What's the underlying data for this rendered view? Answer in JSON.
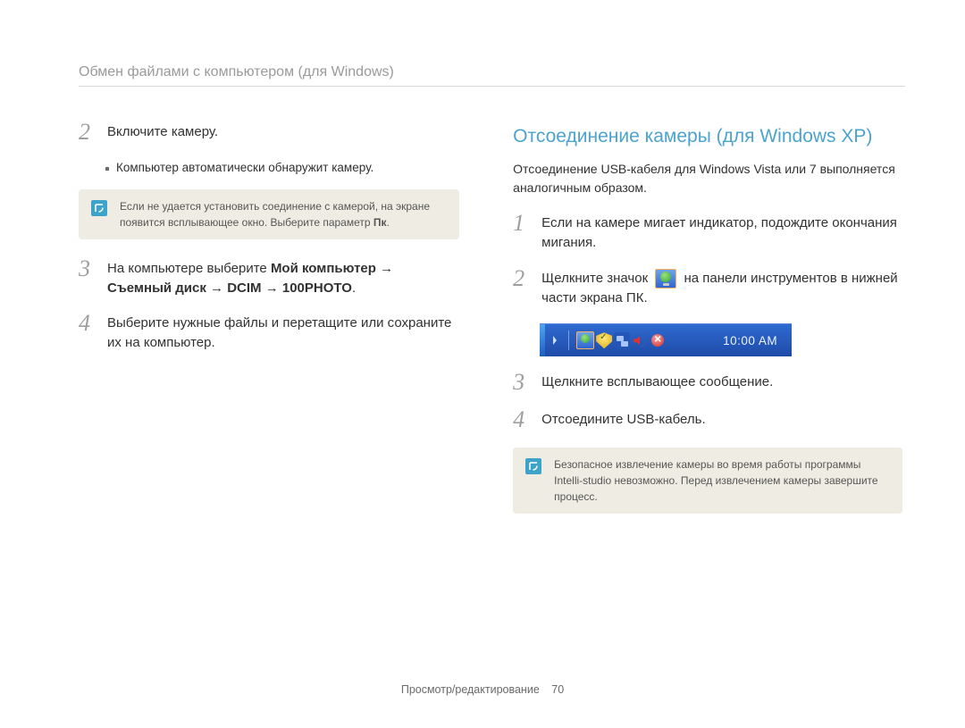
{
  "header_title": "Обмен файлами с компьютером (для Windows)",
  "left": {
    "step2_num": "2",
    "step2_text": "Включите камеру.",
    "step2_bullet": "Компьютер автоматически обнаружит камеру.",
    "note1_part1": "Если не удается установить соединение с камерой, на экране появится всплывающее окно. Выберите параметр ",
    "note1_bold": "Пк",
    "note1_part2": ".",
    "step3_num": "3",
    "step3_pre": "На компьютере выберите ",
    "step3_b1": "Мой компьютер",
    "step3_arrow1": " → ",
    "step3_b2": "Съемный диск",
    "step3_arrow2": " → ",
    "step3_b3": "DCIM",
    "step3_arrow3": " → ",
    "step3_b4": "100PHOTO",
    "step3_end": ".",
    "step4_num": "4",
    "step4_text": "Выберите нужные файлы и перетащите или сохраните их на компьютер."
  },
  "right": {
    "heading": "Отсоединение камеры (для Windows XP)",
    "intro": "Отсоединение USB-кабеля для Windows Vista или 7 выполняется аналогичным образом.",
    "step1_num": "1",
    "step1_text": "Если на камере мигает индикатор, подождите окончания мигания.",
    "step2_num": "2",
    "step2_pre": "Щелкните значок ",
    "step2_post": " на панели инструментов в нижней части экрана ПК.",
    "tray_clock": "10:00 AM",
    "step3_num": "3",
    "step3_text": "Щелкните всплывающее сообщение.",
    "step4_num": "4",
    "step4_text": "Отсоедините USB-кабель.",
    "note2": "Безопасное извлечение камеры во время работы программы Intelli-studio невозможно. Перед извлечением камеры завершите процесс."
  },
  "footer_section": "Просмотр/редактирование",
  "footer_page": "70"
}
